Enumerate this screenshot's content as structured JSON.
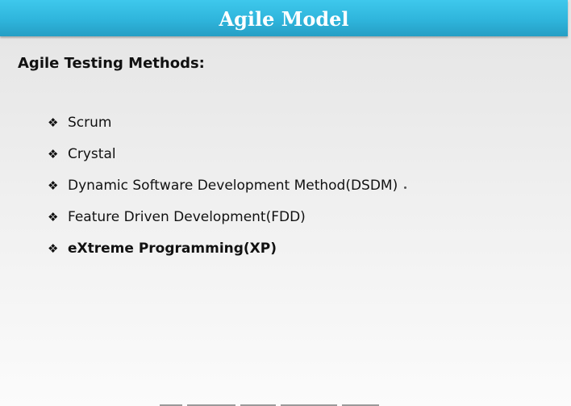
{
  "slide": {
    "title": "Agile Model",
    "subtitle": "Agile Testing Methods:",
    "bullet_glyph": "❖",
    "methods": [
      "Scrum",
      "Crystal",
      "Dynamic Software Development Method(DSDM)",
      "Feature Driven Development(FDD)",
      "eXtreme Programming(XP)"
    ]
  },
  "colors": {
    "title_bar": "#2fb5dc",
    "title_text": "#ffffff",
    "body_text": "#111111"
  }
}
